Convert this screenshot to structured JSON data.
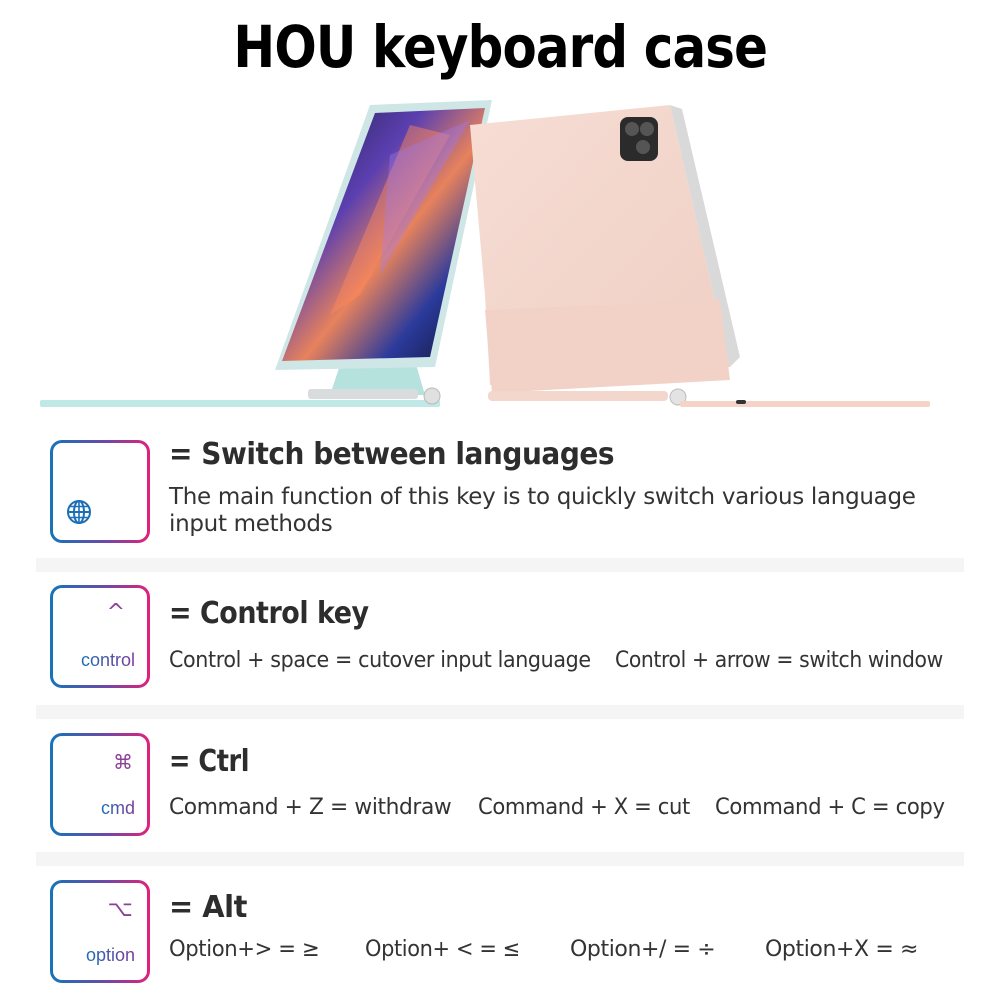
{
  "title": "HOU keyboard case",
  "hero": {
    "products": [
      {
        "name": "ipad-with-mint-keyboard-case",
        "case_color": "#b9e6e3"
      },
      {
        "name": "ipad-with-pink-keyboard-case",
        "case_color": "#f4d6cc"
      }
    ]
  },
  "sections": [
    {
      "key_icon": "globe-icon",
      "key_glyph": "",
      "key_label": "",
      "heading": "= Switch between languages",
      "description_lines": [
        "The main function of this key is to quickly switch various language",
        "input methods"
      ],
      "shortcuts": []
    },
    {
      "key_icon": "caret-icon",
      "key_glyph": "^",
      "key_label": "control",
      "heading": "= Control key",
      "description_lines": [],
      "shortcuts": [
        "Control + space = cutover  input  language",
        "Control + arrow = switch window"
      ]
    },
    {
      "key_icon": "command-icon",
      "key_glyph": "⌘",
      "key_label": "cmd",
      "heading": "= Ctrl",
      "description_lines": [],
      "shortcuts": [
        "Command + Z = withdraw",
        "Command + X = cut",
        "Command + C = copy"
      ]
    },
    {
      "key_icon": "option-icon",
      "key_glyph": "⌥",
      "key_label": "option",
      "heading": "=  Alt",
      "description_lines": [],
      "shortcuts": [
        "Option+> = ≥",
        "Option+ < = ≤",
        "Option+/ = ÷",
        "Option+X =  ≈"
      ]
    }
  ],
  "colors": {
    "key_border_start": "#1574b9",
    "key_border_end": "#e3207a",
    "key_glyph": "#8e3f9b",
    "separator": "#f5f5f5"
  }
}
